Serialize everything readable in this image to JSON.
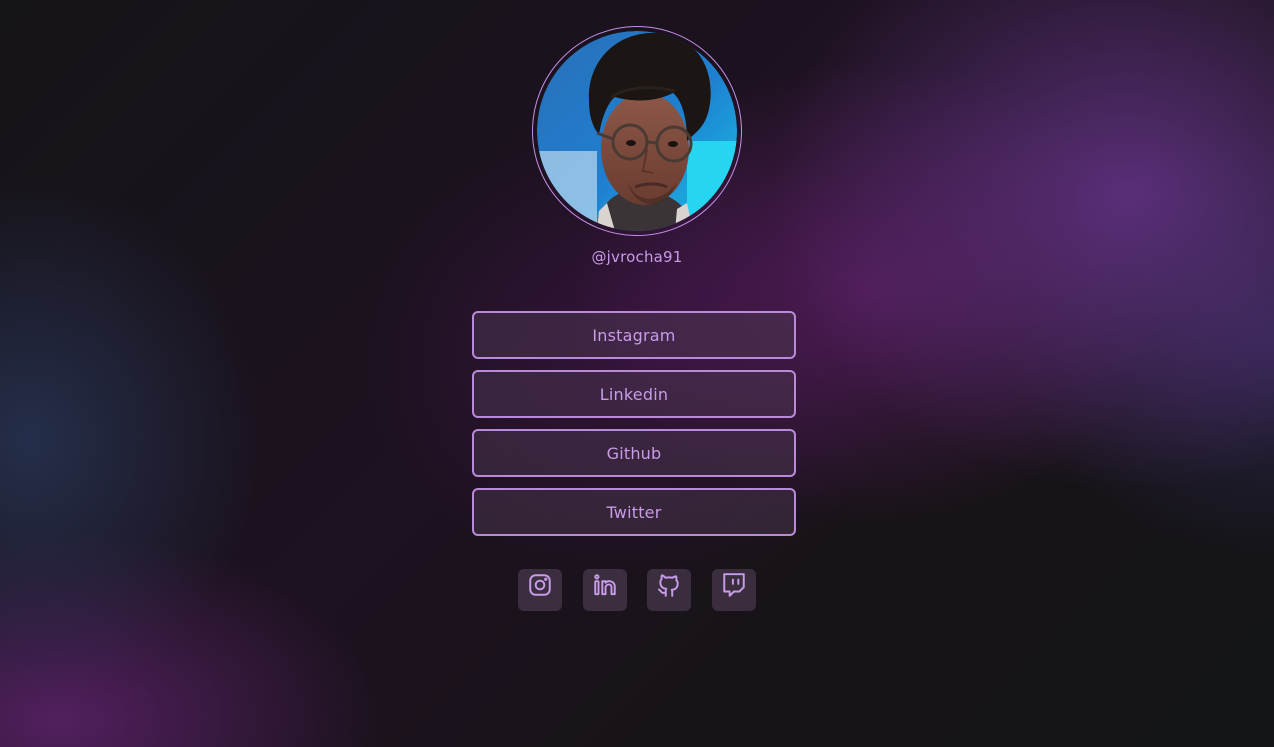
{
  "profile": {
    "username": "@jvrocha91",
    "avatar_icon": "profile-photo"
  },
  "links": [
    {
      "label": "Instagram"
    },
    {
      "label": "Linkedin"
    },
    {
      "label": "Github"
    },
    {
      "label": "Twitter"
    }
  ],
  "socials": [
    {
      "icon": "instagram-icon"
    },
    {
      "icon": "linkedin-icon"
    },
    {
      "icon": "github-icon"
    },
    {
      "icon": "twitch-icon"
    }
  ],
  "colors": {
    "accent": "#c89ce6",
    "border": "#b98ad8",
    "background": "#131116"
  }
}
